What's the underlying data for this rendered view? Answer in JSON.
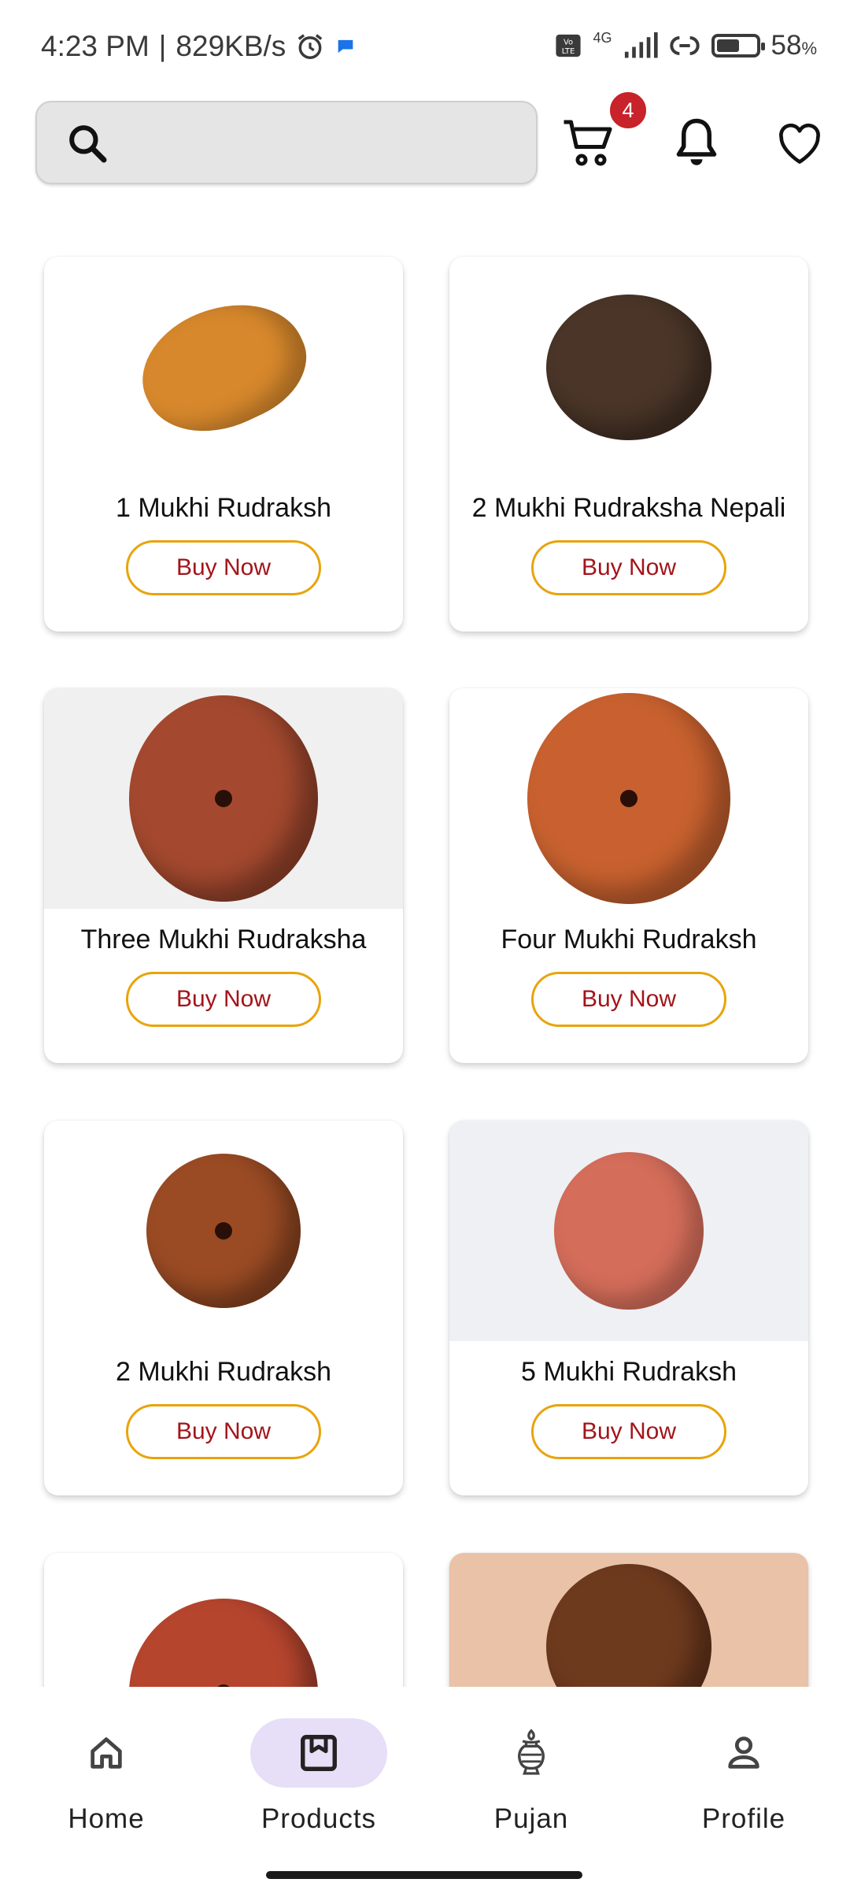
{
  "status_bar": {
    "time": "4:23 PM",
    "speed": "829KB/s",
    "network": "4G",
    "battery": "58",
    "battery_unit": "%",
    "battery_level": 0.58
  },
  "header": {
    "search_placeholder": "",
    "cart_count": "4"
  },
  "products": [
    {
      "name": "1 Mukhi Rudraksh",
      "buy_label": "Buy Now",
      "bead_color": "#d7882c",
      "image_bg": "#ffffff"
    },
    {
      "name": "2 Mukhi Rudraksha Nepali",
      "buy_label": "Buy Now",
      "bead_color": "#4a3528",
      "image_bg": "#ffffff"
    },
    {
      "name": "Three Mukhi Rudraksha",
      "buy_label": "Buy Now",
      "bead_color": "#a4492f",
      "image_bg": "#f0f0f0"
    },
    {
      "name": "Four Mukhi Rudraksh",
      "buy_label": "Buy Now",
      "bead_color": "#c8612f",
      "image_bg": "#ffffff"
    },
    {
      "name": "2 Mukhi Rudraksh",
      "buy_label": "Buy Now",
      "bead_color": "#9a4b24",
      "image_bg": "#ffffff"
    },
    {
      "name": "5 Mukhi Rudraksh",
      "buy_label": "Buy Now",
      "bead_color": "#d46d5a",
      "image_bg": "#eef0f4"
    },
    {
      "name": "",
      "buy_label": "",
      "bead_color": "#b6452e",
      "image_bg": "#ffffff"
    },
    {
      "name": "",
      "buy_label": "",
      "bead_color": "#6e3a1e",
      "image_bg": "#e9c2a8"
    }
  ],
  "bottom_nav": [
    {
      "label": "Home",
      "icon": "home-icon",
      "active": false
    },
    {
      "label": "Products",
      "icon": "products-icon",
      "active": true
    },
    {
      "label": "Pujan",
      "icon": "kalash-icon",
      "active": false
    },
    {
      "label": "Profile",
      "icon": "profile-icon",
      "active": false
    }
  ],
  "colors": {
    "accent_border": "#e8a40c",
    "button_text": "#a3141a",
    "badge": "#c8222a",
    "nav_active": "#e7def7"
  }
}
